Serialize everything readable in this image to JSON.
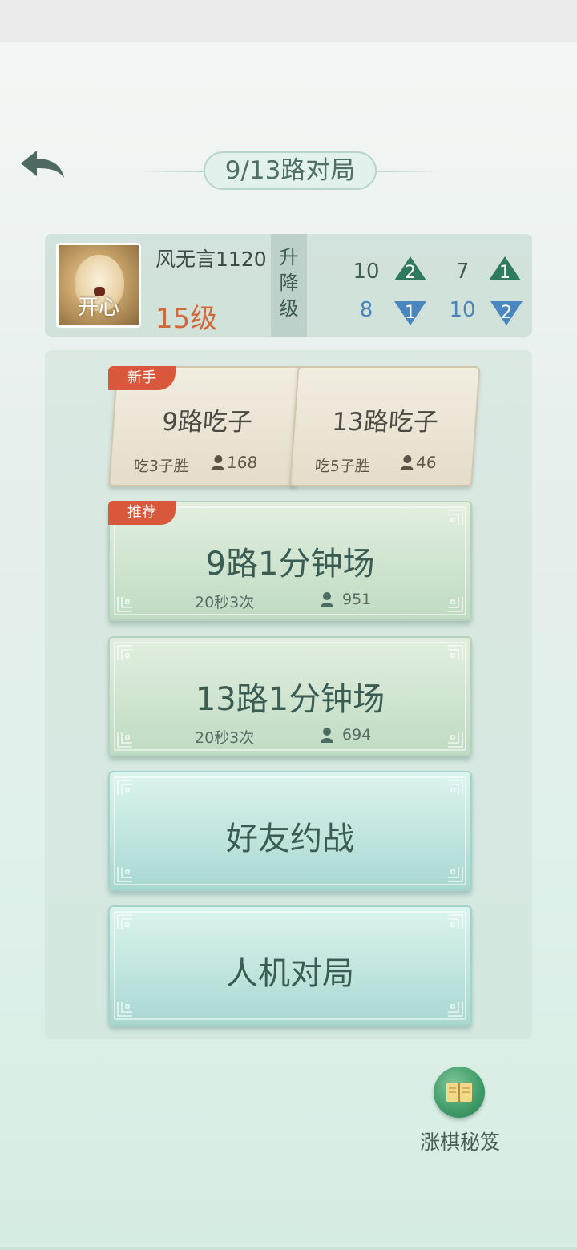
{
  "header": {
    "title": "9/13路对局",
    "back_icon": "back-arrow-icon"
  },
  "profile": {
    "avatar_caption": "开心",
    "name": "风无言1120",
    "level": "15级",
    "rank_label_chars": [
      "升",
      "降",
      "级"
    ],
    "stats": {
      "nine_up": "10",
      "nine_up_badge": "2",
      "nine_down": "8",
      "nine_down_badge": "1",
      "thirteen_up": "7",
      "thirteen_up_badge": "1",
      "thirteen_down": "10",
      "thirteen_down_badge": "2"
    }
  },
  "modes": {
    "capture9": {
      "badge": "新手",
      "title": "9路吃子",
      "rule": "吃3子胜",
      "players": "168"
    },
    "capture13": {
      "title": "13路吃子",
      "rule": "吃5子胜",
      "players": "46"
    },
    "blitz9": {
      "badge": "推荐",
      "title": "9路1分钟场",
      "rule": "20秒3次",
      "players": "951"
    },
    "blitz13": {
      "title": "13路1分钟场",
      "rule": "20秒3次",
      "players": "694"
    },
    "friends": {
      "title": "好友约战"
    },
    "ai": {
      "title": "人机对局"
    }
  },
  "tips": {
    "label": "涨棋秘笈",
    "icon": "book-icon"
  },
  "colors": {
    "up_triangle": "#2f7a5c",
    "down_triangle": "#4a86c0",
    "badge_red": "#d9573a",
    "level_orange": "#cf6a3d"
  }
}
